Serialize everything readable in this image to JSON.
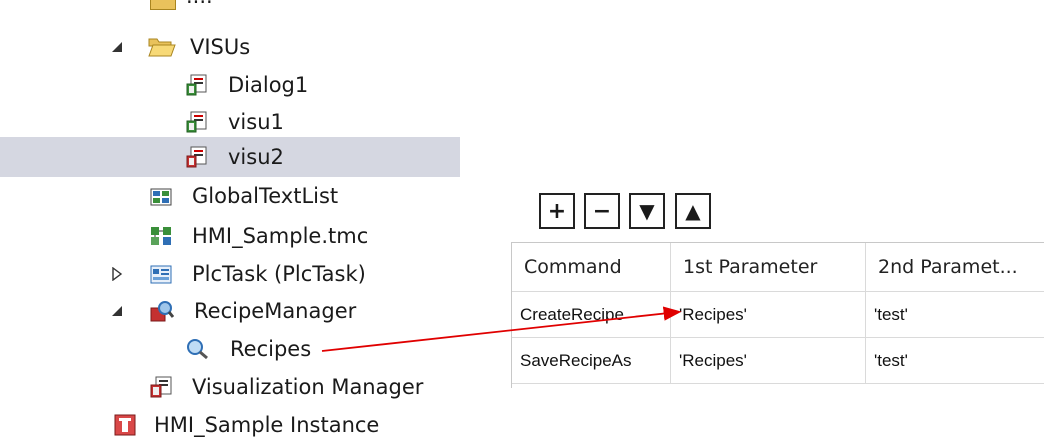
{
  "tree": {
    "items": [
      {
        "label": "VISUs"
      },
      {
        "label": "Dialog1"
      },
      {
        "label": "visu1"
      },
      {
        "label": "visu2"
      },
      {
        "label": "GlobalTextList"
      },
      {
        "label": "HMI_Sample.tmc"
      },
      {
        "label": "PlcTask (PlcTask)"
      },
      {
        "label": "RecipeManager"
      },
      {
        "label": "Recipes"
      },
      {
        "label": "Visualization Manager"
      },
      {
        "label": "HMI_Sample Instance"
      }
    ]
  },
  "recipe_editor": {
    "toolbar": {
      "add": "+",
      "remove": "−",
      "down": "▼",
      "up": "▲"
    },
    "columns": [
      "Command",
      "1st Parameter",
      "2nd Paramet..."
    ],
    "rows": [
      [
        "CreateRecipe",
        "'Recipes'",
        "'test'"
      ],
      [
        "SaveRecipeAs",
        "'Recipes'",
        "'test'"
      ]
    ]
  },
  "colors": {
    "selection": "#d5d7e1",
    "annotation_arrow": "#e00000",
    "folder": "#f2c65a"
  }
}
